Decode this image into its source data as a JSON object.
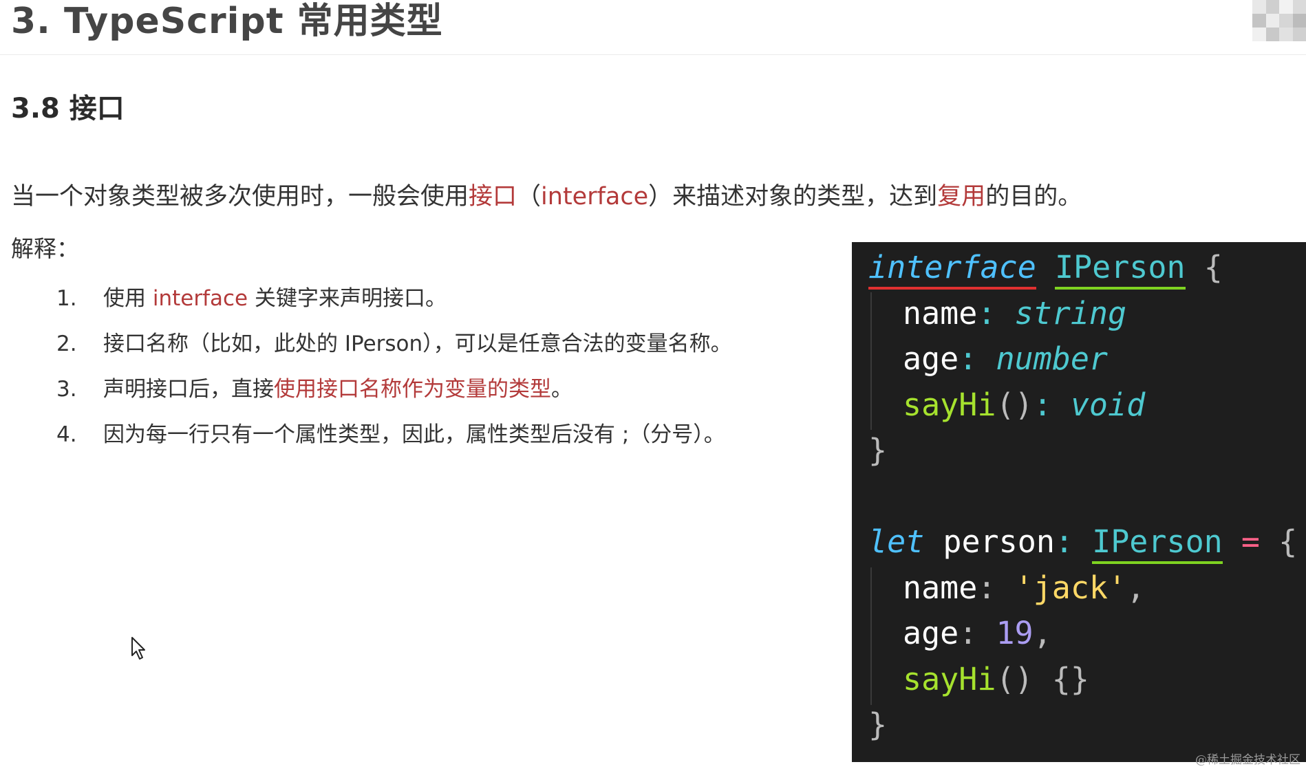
{
  "header": {
    "chapter_title": "3. TypeScript 常用类型"
  },
  "avatar_colors": [
    "#e8e8e8",
    "#cfcfcf",
    "#f2f2f2",
    "#dadada",
    "#c4c4c4",
    "#ececec",
    "#d6d6d6",
    "#bcbcbc",
    "#f0f0f0",
    "#c9c9c9",
    "#e1e1e1",
    "#d0d0d0"
  ],
  "section": {
    "title": "3.8 接口"
  },
  "intro": {
    "part1": "当一个对象类型被多次使用时，一般会使用",
    "highlight1": "接口",
    "part2": "（",
    "highlight2": "interface",
    "part3": "）来描述对象的类型，达到",
    "highlight3": "复用",
    "part4": "的目的。"
  },
  "explain_label": "解释：",
  "notes": [
    {
      "num": "1.",
      "pre": "使用 ",
      "hl": "interface",
      "post": " 关键字来声明接口。"
    },
    {
      "num": "2.",
      "pre": "接口名称（比如，此处的 IPerson），可以是任意合法的变量名称。",
      "hl": "",
      "post": ""
    },
    {
      "num": "3.",
      "pre": "声明接口后，直接",
      "hl": "使用接口名称作为变量的类型",
      "post": "。"
    },
    {
      "num": "4.",
      "pre": "因为每一行只有一个属性类型，因此，属性类型后没有 ;（分号）。",
      "hl": "",
      "post": ""
    }
  ],
  "code": {
    "kw_interface": "interface",
    "iface_name": "IPerson",
    "open_brace": "{",
    "close_brace": "}",
    "prop_name": "name",
    "prop_age": "age",
    "prop_sayhi": "sayHi",
    "parens": "()",
    "colon": ":",
    "type_string": "string",
    "type_number": "number",
    "type_void": "void",
    "kw_let": "let",
    "var_person": "person",
    "equals": "=",
    "str_jack": "'jack'",
    "num_19": "19",
    "comma": ",",
    "empty_body": "{}"
  },
  "watermark": "@稀土掘金技术社区",
  "colors": {
    "highlight": "#b33a3a",
    "code_bg": "#1e1e1e",
    "keyword": "#4fc1ff",
    "type": "#4ec9d0",
    "function": "#a6e22e",
    "string": "#ffd866",
    "number": "#ab9df2",
    "operator": "#ff6188",
    "underline_red": "#e03030",
    "underline_green": "#7ed321"
  }
}
